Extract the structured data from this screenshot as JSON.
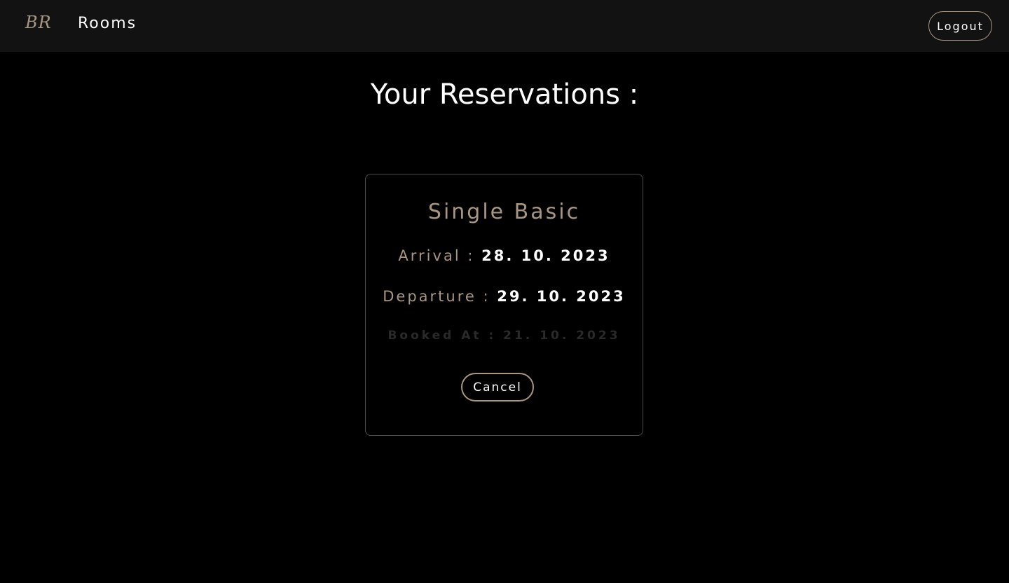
{
  "header": {
    "logo_text": "BR",
    "nav_rooms_label": "Rooms",
    "logout_label": "Logout"
  },
  "page": {
    "title": "Your Reservations :"
  },
  "reservations": [
    {
      "room_name": "Single Basic",
      "arrival_label": "Arrival :",
      "arrival_value": "28. 10. 2023",
      "departure_label": "Departure :",
      "departure_value": "29. 10. 2023",
      "booked_text": "Booked At : 21. 10. 2023",
      "cancel_label": "Cancel"
    }
  ],
  "colors": {
    "accent": "#a89680",
    "background": "#000000",
    "header_background": "#121212",
    "text": "#ffffff",
    "muted": "#2a2a2a",
    "card_border": "#4a4a4a"
  }
}
